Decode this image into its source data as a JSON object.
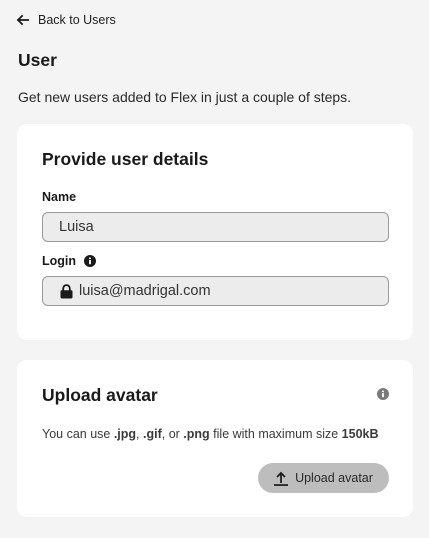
{
  "nav": {
    "back_label": "Back to Users"
  },
  "header": {
    "title": "User",
    "subtitle": "Get new users added to Flex in just a couple of steps."
  },
  "details_card": {
    "title": "Provide user details",
    "name_label": "Name",
    "name_value": "Luisa",
    "login_label": "Login",
    "login_value": "luisa@madrigal.com"
  },
  "avatar_card": {
    "title": "Upload avatar",
    "hint": {
      "prefix": "You can use ",
      "jpg": ".jpg",
      "sep1": ", ",
      "gif": ".gif",
      "sep2": ", or ",
      "png": ".png",
      "mid": " file with maximum size ",
      "size": "150kB"
    },
    "button_label": "Upload avatar"
  },
  "icons": {
    "back": "arrow-left-icon",
    "login_info": "info-icon",
    "lock": "lock-icon",
    "avatar_info": "info-icon",
    "upload": "upload-icon"
  },
  "colors": {
    "background": "#f4f4f4",
    "card": "#ffffff",
    "input_bg": "#ececec",
    "button_bg": "#bdbdbd"
  }
}
